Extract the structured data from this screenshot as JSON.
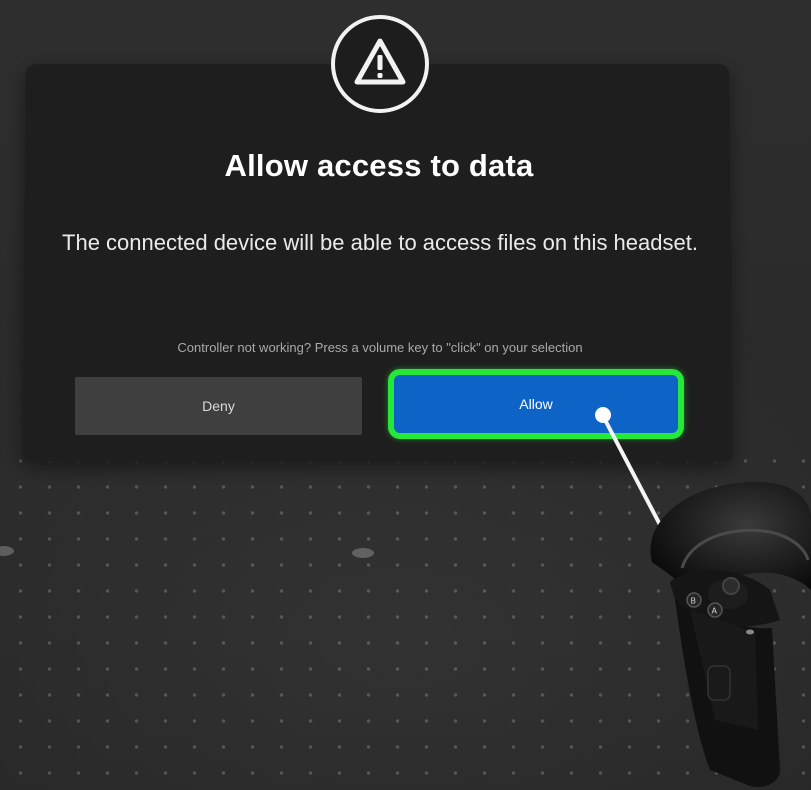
{
  "dialog": {
    "icon": "warning-triangle-icon",
    "title": "Allow access to data",
    "message": "The connected device will be able to access files on this headset.",
    "hint": "Controller not working? Press a volume key to \"click\" on your selection",
    "buttons": {
      "deny": "Deny",
      "allow": "Allow"
    },
    "highlight_color": "#25e83a",
    "allow_color": "#0d63c6"
  },
  "scene": {
    "pointer": "controller-ray",
    "controller": "vr-controller-right"
  }
}
